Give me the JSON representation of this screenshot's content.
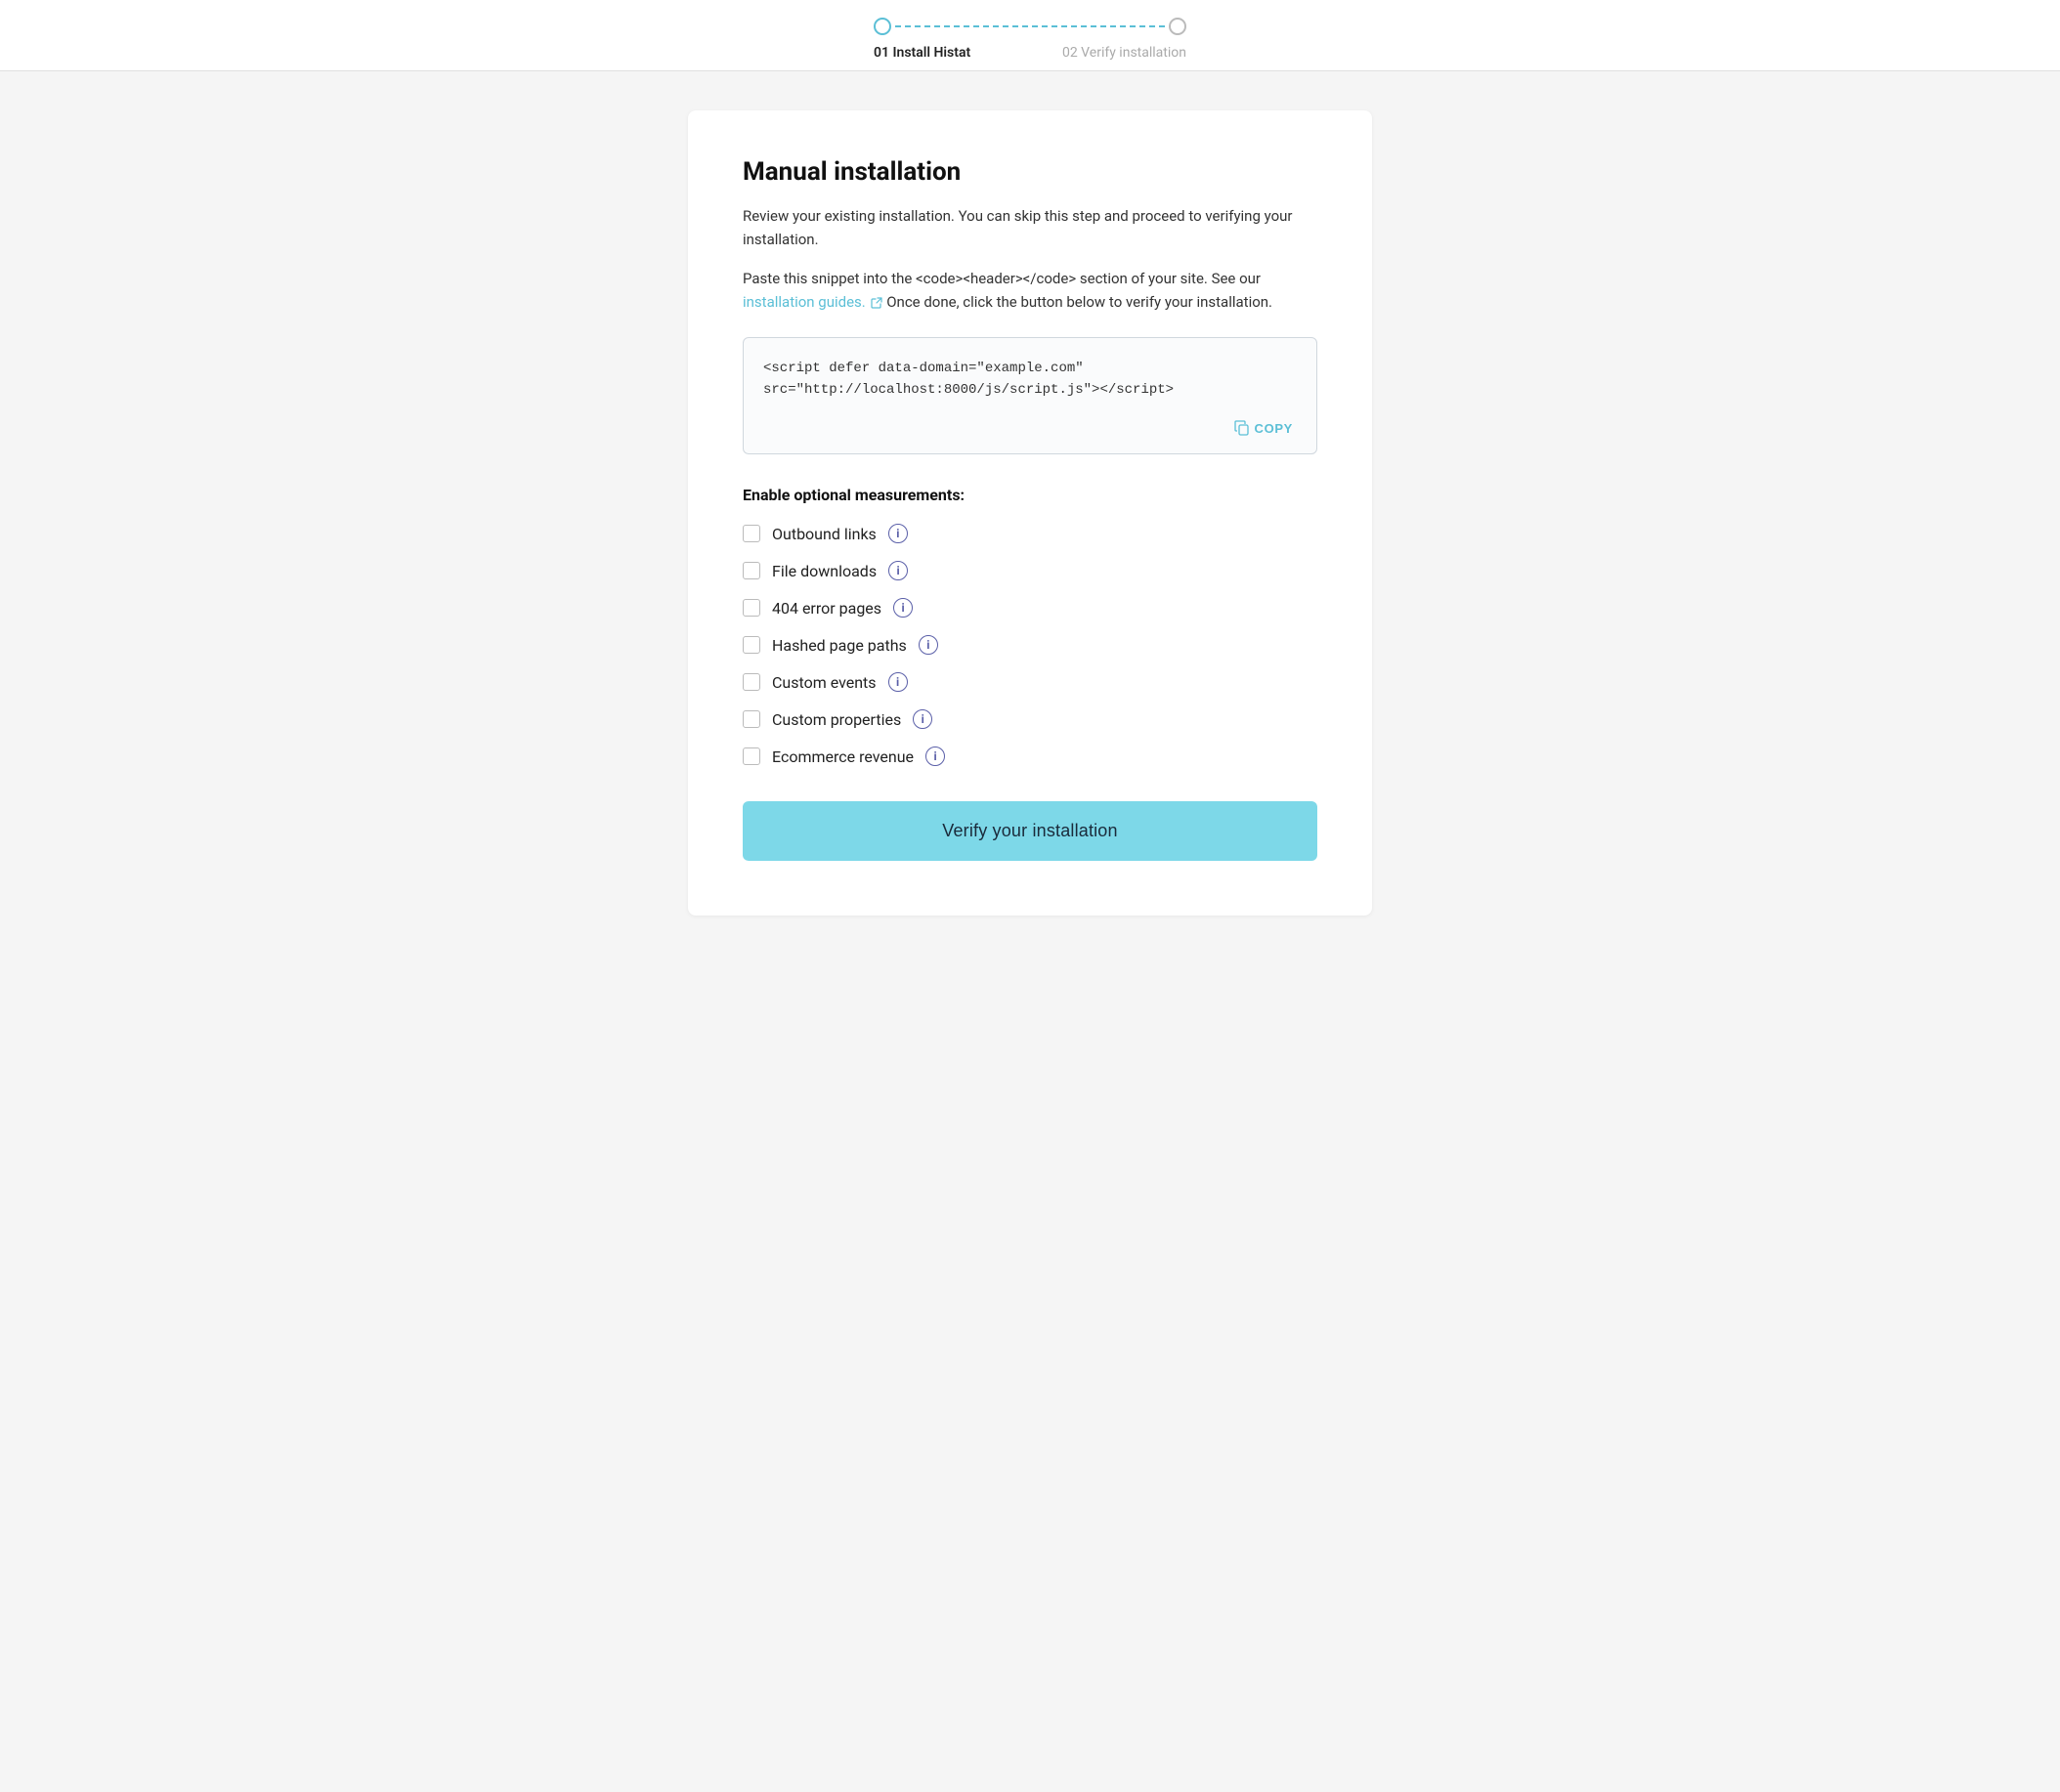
{
  "stepper": {
    "step1_label": "01 Install Histat",
    "step2_label": "02 Verify installation",
    "step1_active": true,
    "step2_active": false
  },
  "main": {
    "title": "Manual installation",
    "description1": "Review your existing installation. You can skip this step and proceed to verifying your installation.",
    "description2_prefix": "Paste this snippet into the <code><header></code> section of your site. See our ",
    "description2_link": "installation guides.",
    "description2_suffix": " Once done, click the button below to verify your installation.",
    "code_snippet": "<script defer data-domain=\"example.com\"\nsrc=\"http://localhost:8000/js/script.js\"></script>",
    "copy_label": "COPY",
    "measurements_title": "Enable optional measurements:",
    "checkboxes": [
      {
        "id": "outbound-links",
        "label": "Outbound links",
        "checked": false
      },
      {
        "id": "file-downloads",
        "label": "File downloads",
        "checked": false
      },
      {
        "id": "404-error-pages",
        "label": "404 error pages",
        "checked": false
      },
      {
        "id": "hashed-page-paths",
        "label": "Hashed page paths",
        "checked": false
      },
      {
        "id": "custom-events",
        "label": "Custom events",
        "checked": false
      },
      {
        "id": "custom-properties",
        "label": "Custom properties",
        "checked": false
      },
      {
        "id": "ecommerce-revenue",
        "label": "Ecommerce revenue",
        "checked": false
      }
    ],
    "verify_btn_label": "Verify your installation"
  }
}
